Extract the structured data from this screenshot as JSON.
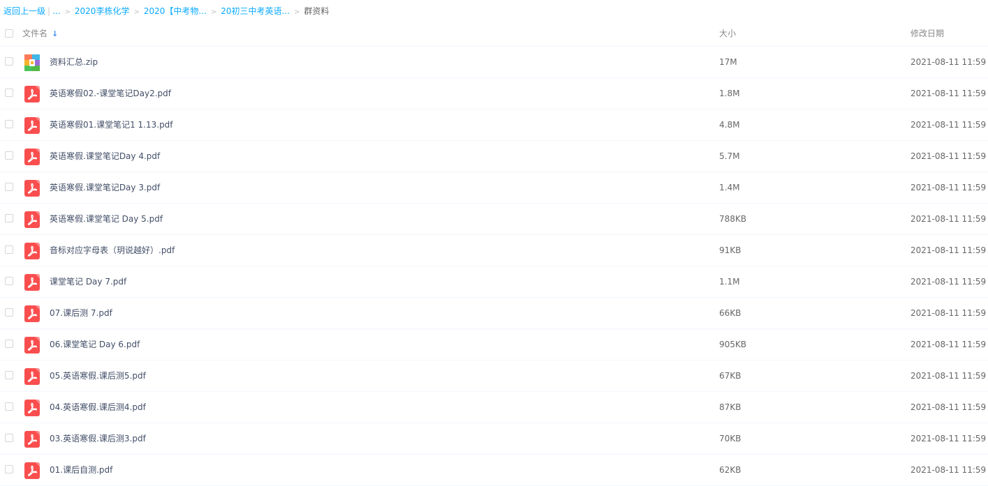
{
  "breadcrumb": {
    "back": "返回上一级",
    "pipe": "|",
    "ellipsis": "...",
    "items": [
      "2020李栋化学",
      "2020【中考物...",
      "20初三中考英语..."
    ],
    "separator": ">",
    "current": "群资料"
  },
  "header": {
    "name": "文件名",
    "sort_icon": "arrow-down-icon",
    "size": "大小",
    "date": "修改日期"
  },
  "colors": {
    "link": "#09aaff",
    "pdf_icon": "#fa4e4e",
    "text": "#424e67"
  },
  "files": [
    {
      "name": "资料汇总.zip",
      "size": "17M",
      "date": "2021-08-11 11:59",
      "icon": "zip-icon"
    },
    {
      "name": "英语寒假02.-课堂笔记Day2.pdf",
      "size": "1.8M",
      "date": "2021-08-11 11:59",
      "icon": "pdf-icon"
    },
    {
      "name": "英语寒假01.课堂笔记1 1.13.pdf",
      "size": "4.8M",
      "date": "2021-08-11 11:59",
      "icon": "pdf-icon"
    },
    {
      "name": "英语寒假.课堂笔记Day 4.pdf",
      "size": "5.7M",
      "date": "2021-08-11 11:59",
      "icon": "pdf-icon"
    },
    {
      "name": "英语寒假.课堂笔记Day 3.pdf",
      "size": "1.4M",
      "date": "2021-08-11 11:59",
      "icon": "pdf-icon"
    },
    {
      "name": "英语寒假.课堂笔记 Day 5.pdf",
      "size": "788KB",
      "date": "2021-08-11 11:59",
      "icon": "pdf-icon"
    },
    {
      "name": "音标对应字母表（玥说越好）.pdf",
      "size": "91KB",
      "date": "2021-08-11 11:59",
      "icon": "pdf-icon"
    },
    {
      "name": "课堂笔记 Day 7.pdf",
      "size": "1.1M",
      "date": "2021-08-11 11:59",
      "icon": "pdf-icon"
    },
    {
      "name": "07.课后测 7.pdf",
      "size": "66KB",
      "date": "2021-08-11 11:59",
      "icon": "pdf-icon"
    },
    {
      "name": "06.课堂笔记 Day 6.pdf",
      "size": "905KB",
      "date": "2021-08-11 11:59",
      "icon": "pdf-icon"
    },
    {
      "name": "05.英语寒假.课后测5.pdf",
      "size": "67KB",
      "date": "2021-08-11 11:59",
      "icon": "pdf-icon"
    },
    {
      "name": "04.英语寒假.课后测4.pdf",
      "size": "87KB",
      "date": "2021-08-11 11:59",
      "icon": "pdf-icon"
    },
    {
      "name": "03.英语寒假.课后测3.pdf",
      "size": "70KB",
      "date": "2021-08-11 11:59",
      "icon": "pdf-icon"
    },
    {
      "name": "01.课后自测.pdf",
      "size": "62KB",
      "date": "2021-08-11 11:59",
      "icon": "pdf-icon"
    }
  ]
}
